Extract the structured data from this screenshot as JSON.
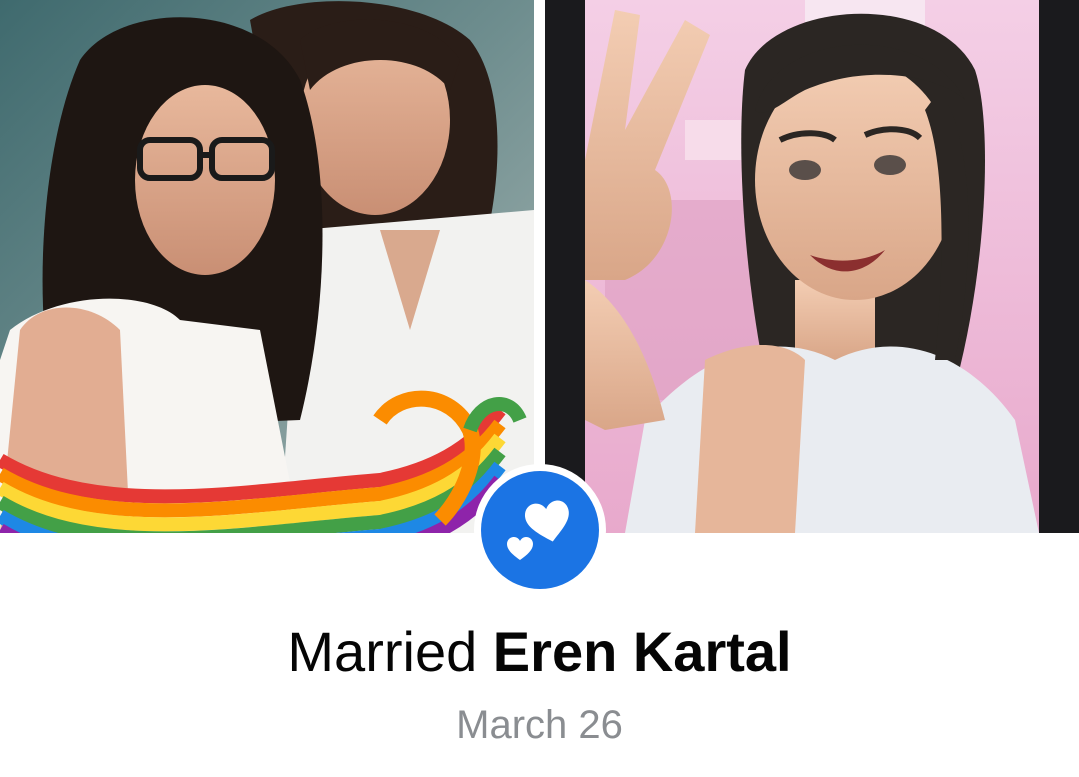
{
  "life_event": {
    "icon": "hearts-icon",
    "accent_color": "#1b74e4",
    "status_label": "Married",
    "partner_name": "Eren Kartal",
    "date": "March 26"
  },
  "photos": [
    {
      "description_name": "couple-photo"
    },
    {
      "description_name": "partner-cartoon-photo"
    }
  ]
}
